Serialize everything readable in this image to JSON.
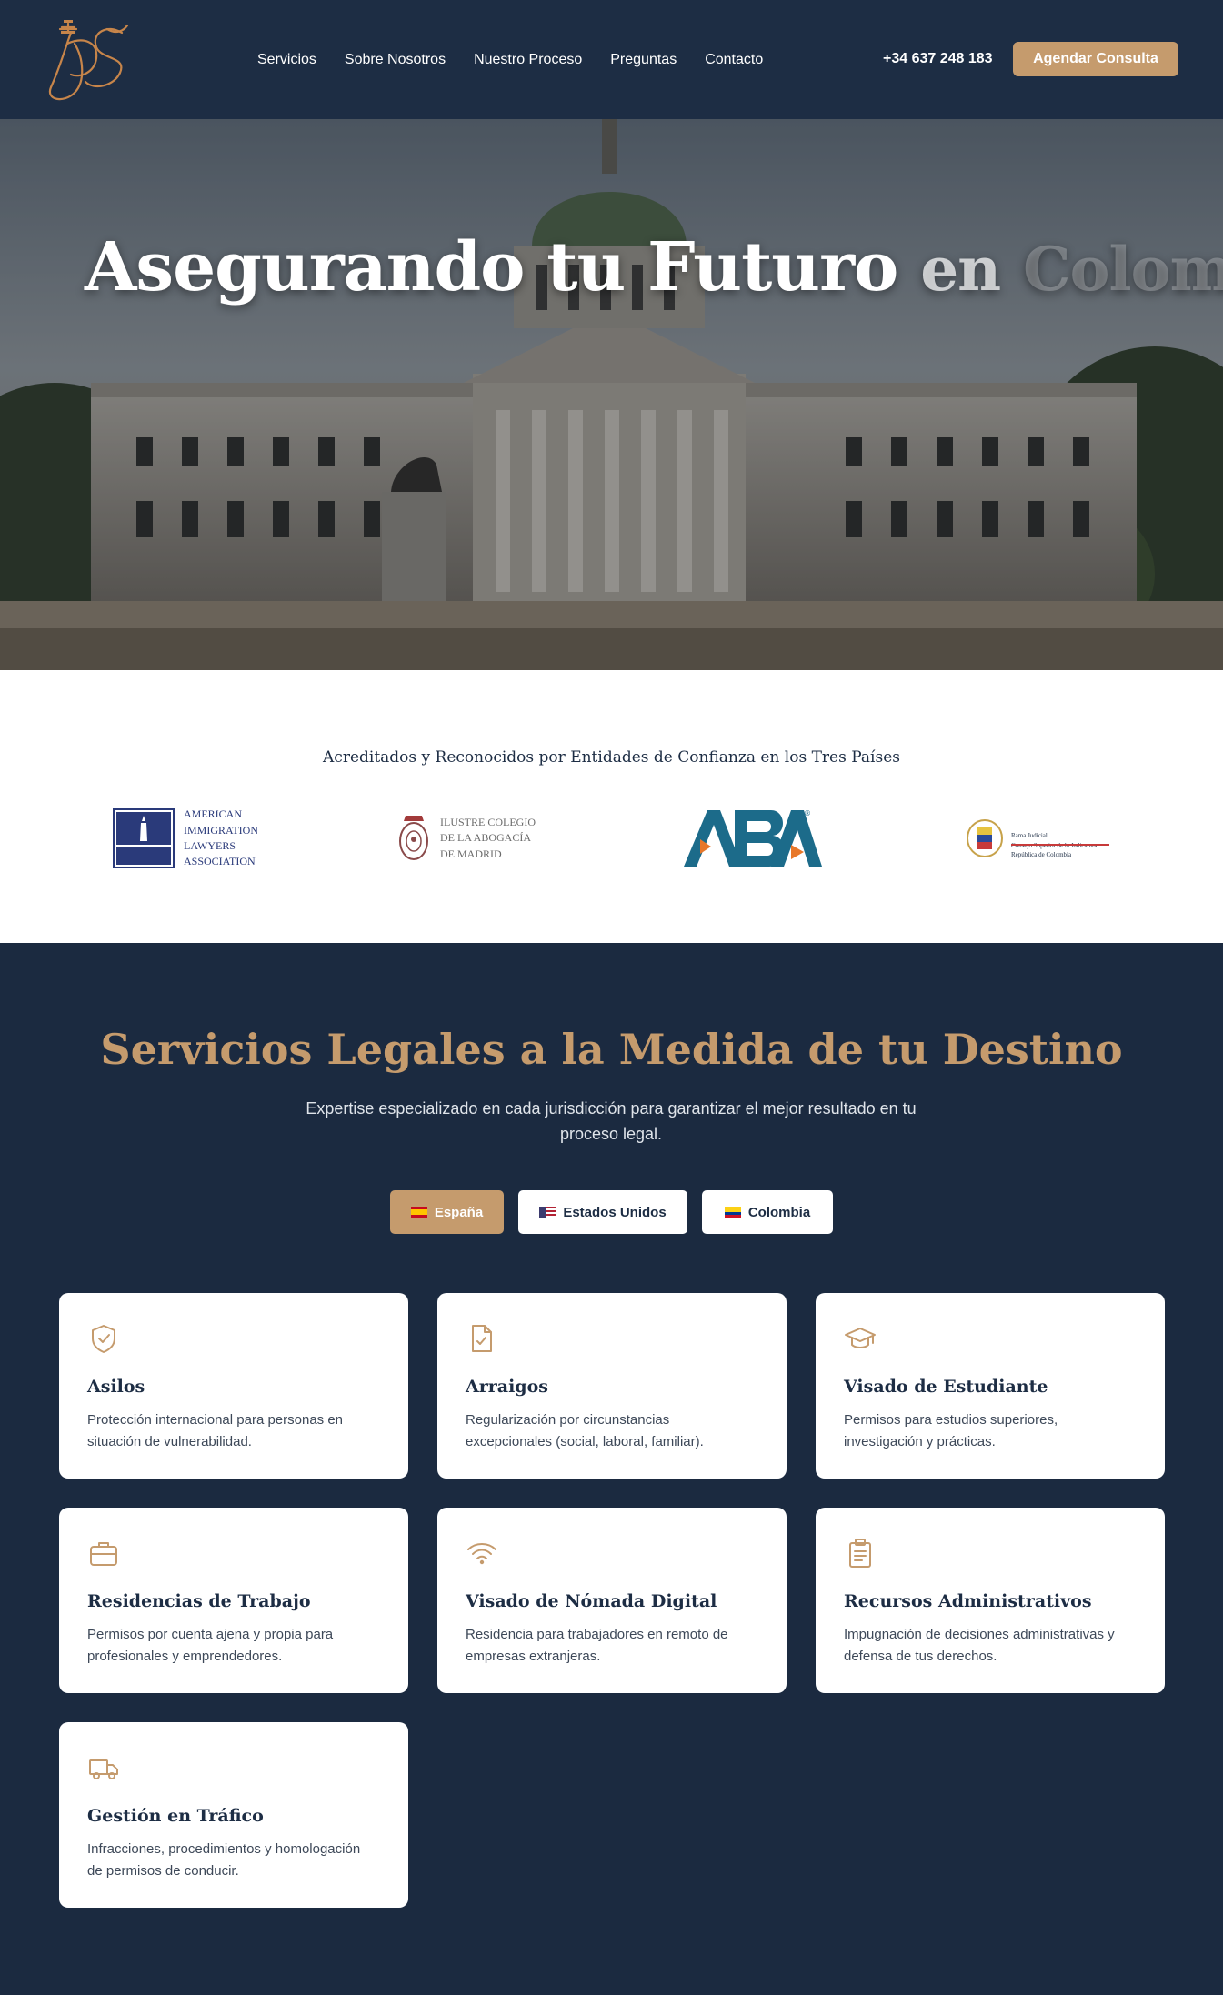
{
  "header": {
    "nav": [
      "Servicios",
      "Sobre Nosotros",
      "Nuestro Proceso",
      "Preguntas",
      "Contacto"
    ],
    "phone": "+34 637 248 183",
    "cta": "Agendar Consulta"
  },
  "hero": {
    "title_part1": "Asegurando tu Futuro",
    "title_part2": "en",
    "title_part3": "Colombia"
  },
  "accreditation": {
    "title": "Acreditados y Reconocidos por Entidades de Confianza en los Tres Países",
    "partners": [
      {
        "name": "AILA",
        "text": "AMERICAN\nIMMIGRATION\nLAWYERS\nASSOCIATION"
      },
      {
        "name": "ICAM",
        "text": "ILUSTRE COLEGIO\nDE LA ABOGACÍA\nDE MADRID"
      },
      {
        "name": "ABA",
        "text": "ABA"
      },
      {
        "name": "Rama Judicial",
        "text": "Rama Judicial\nConsejo Superior de la Judicatura\nRepública de Colombia"
      }
    ]
  },
  "services": {
    "title": "Servicios Legales a la Medida de tu Destino",
    "subtitle": "Expertise especializado en cada jurisdicción para garantizar el mejor resultado en tu proceso legal.",
    "tabs": [
      "España",
      "Estados Unidos",
      "Colombia"
    ],
    "active_tab": "España",
    "cards": [
      {
        "title": "Asilos",
        "desc": "Protección internacional para personas en situación de vulnerabilidad.",
        "icon": "shield-check-icon"
      },
      {
        "title": "Arraigos",
        "desc": "Regularización por circunstancias excepcionales (social, laboral, familiar).",
        "icon": "document-check-icon"
      },
      {
        "title": "Visado de Estudiante",
        "desc": "Permisos para estudios superiores, investigación y prácticas.",
        "icon": "graduation-cap-icon"
      },
      {
        "title": "Residencias de Trabajo",
        "desc": "Permisos por cuenta ajena y propia para profesionales y emprendedores.",
        "icon": "briefcase-icon"
      },
      {
        "title": "Visado de Nómada Digital",
        "desc": "Residencia para trabajadores en remoto de empresas extranjeras.",
        "icon": "wifi-icon"
      },
      {
        "title": "Recursos Administrativos",
        "desc": "Impugnación de decisiones administrativas y defensa de tus derechos.",
        "icon": "clipboard-icon"
      },
      {
        "title": "Gestión en Tráfico",
        "desc": "Infracciones, procedimientos y homologación de permisos de conducir.",
        "icon": "truck-icon"
      }
    ]
  },
  "colors": {
    "navy": "#1b2a40",
    "gold": "#c59b6d",
    "white": "#ffffff"
  }
}
